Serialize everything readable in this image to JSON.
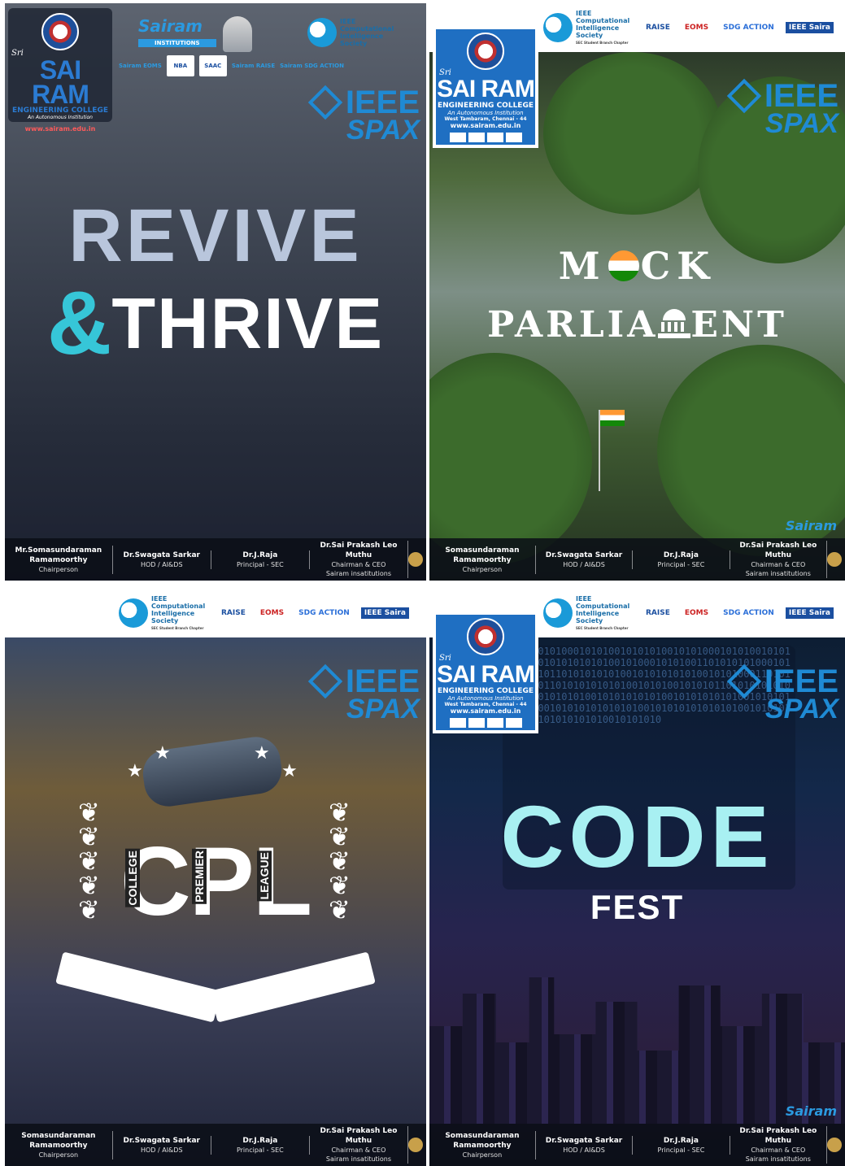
{
  "college": {
    "sri": "Sri",
    "name": "SAI RAM",
    "sub": "ENGINEERING COLLEGE",
    "autonomous": "An Autonomous Institution",
    "address": "West Tambaram, Chennai - 44",
    "url": "www.sairam.edu.in"
  },
  "partners": {
    "sairam": "Sairam",
    "institutions": "INSTITUTIONS",
    "cis_line1": "IEEE",
    "cis_line2": "Computational",
    "cis_line3": "Intelligence",
    "cis_line4": "Society",
    "cis_sub": "SEC Student Branch Chapter",
    "raise": "RAISE",
    "eoms": "EOMS",
    "sdg": "SDG ACTION",
    "ieee_sairam": "IEEE Saira",
    "nba": "NBA",
    "saac": "SAAC",
    "sairam_raise": "Sairam RAISE",
    "sairam_sdg": "Sairam SDG ACTION",
    "sairam_eoms": "Sairam EOMS"
  },
  "spax": {
    "ieee": "IEEE",
    "spax": "SPAX"
  },
  "posters": {
    "revive": {
      "line1": "REVIVE",
      "amp": "&",
      "line2": "THRIVE"
    },
    "mock": {
      "m": "M",
      "ck": "CK",
      "parl_left": "PARLIA",
      "parl_right": "ENT"
    },
    "cpl": {
      "big": "CPL",
      "college": "COLLEGE",
      "premier": "PREMIER",
      "league": "LEAGUE"
    },
    "code": {
      "line1": "CODE",
      "line2": "FEST"
    }
  },
  "footer": {
    "p1_name": "Mr.Somasundaraman",
    "p1_name2": "Ramamoorthy",
    "p1_role": "Chairperson",
    "name": "Somasundaraman",
    "name2": "Ramamoorthy",
    "role": "Chairperson",
    "hod_name": "Dr.Swagata Sarkar",
    "hod_role": "HOD / AI&DS",
    "principal_name": "Dr.J.Raja",
    "principal_role": "Principal - SEC",
    "chair_name": "Dr.Sai Prakash Leo Muthu",
    "chair_role": "Chairman & CEO",
    "chair_org": "Sairam insatitutions"
  },
  "binary_text": "010101010100010101001010101001010100010101001010100101101010101010100101000101010011010101010001010011101011010101010100101010101010010101000110101010001011010101010101001010100101010110101010101010100101010101001010101010100101010101010010101010101010010101010101010100101010101010101001010101010100101010101010010101010"
}
